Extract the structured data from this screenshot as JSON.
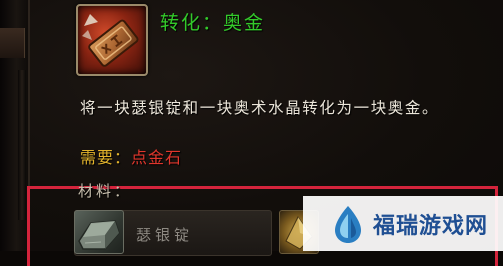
{
  "recipe": {
    "title": "转化：奥金",
    "icon": "transmute-gold-icon",
    "description": "将一块瑟银锭和一块奥术水晶转化为一块奥金。",
    "requires_label": "需要：",
    "requires_tool": "点金石",
    "materials_label": "材料：",
    "materials": [
      {
        "name": "瑟银锭",
        "icon": "thorium-bar-icon"
      },
      {
        "name": "",
        "icon": "arcane-crystal-icon"
      }
    ]
  },
  "colors": {
    "title": "#33c92a",
    "description": "#ece6da",
    "requires_label": "#e2b32c",
    "requires_tool": "#e0362c",
    "highlight": "#d4243c",
    "watermark_text": "#1f4f93"
  },
  "watermark": {
    "text": "福瑞游戏网",
    "icon": "furui-logo-icon"
  }
}
